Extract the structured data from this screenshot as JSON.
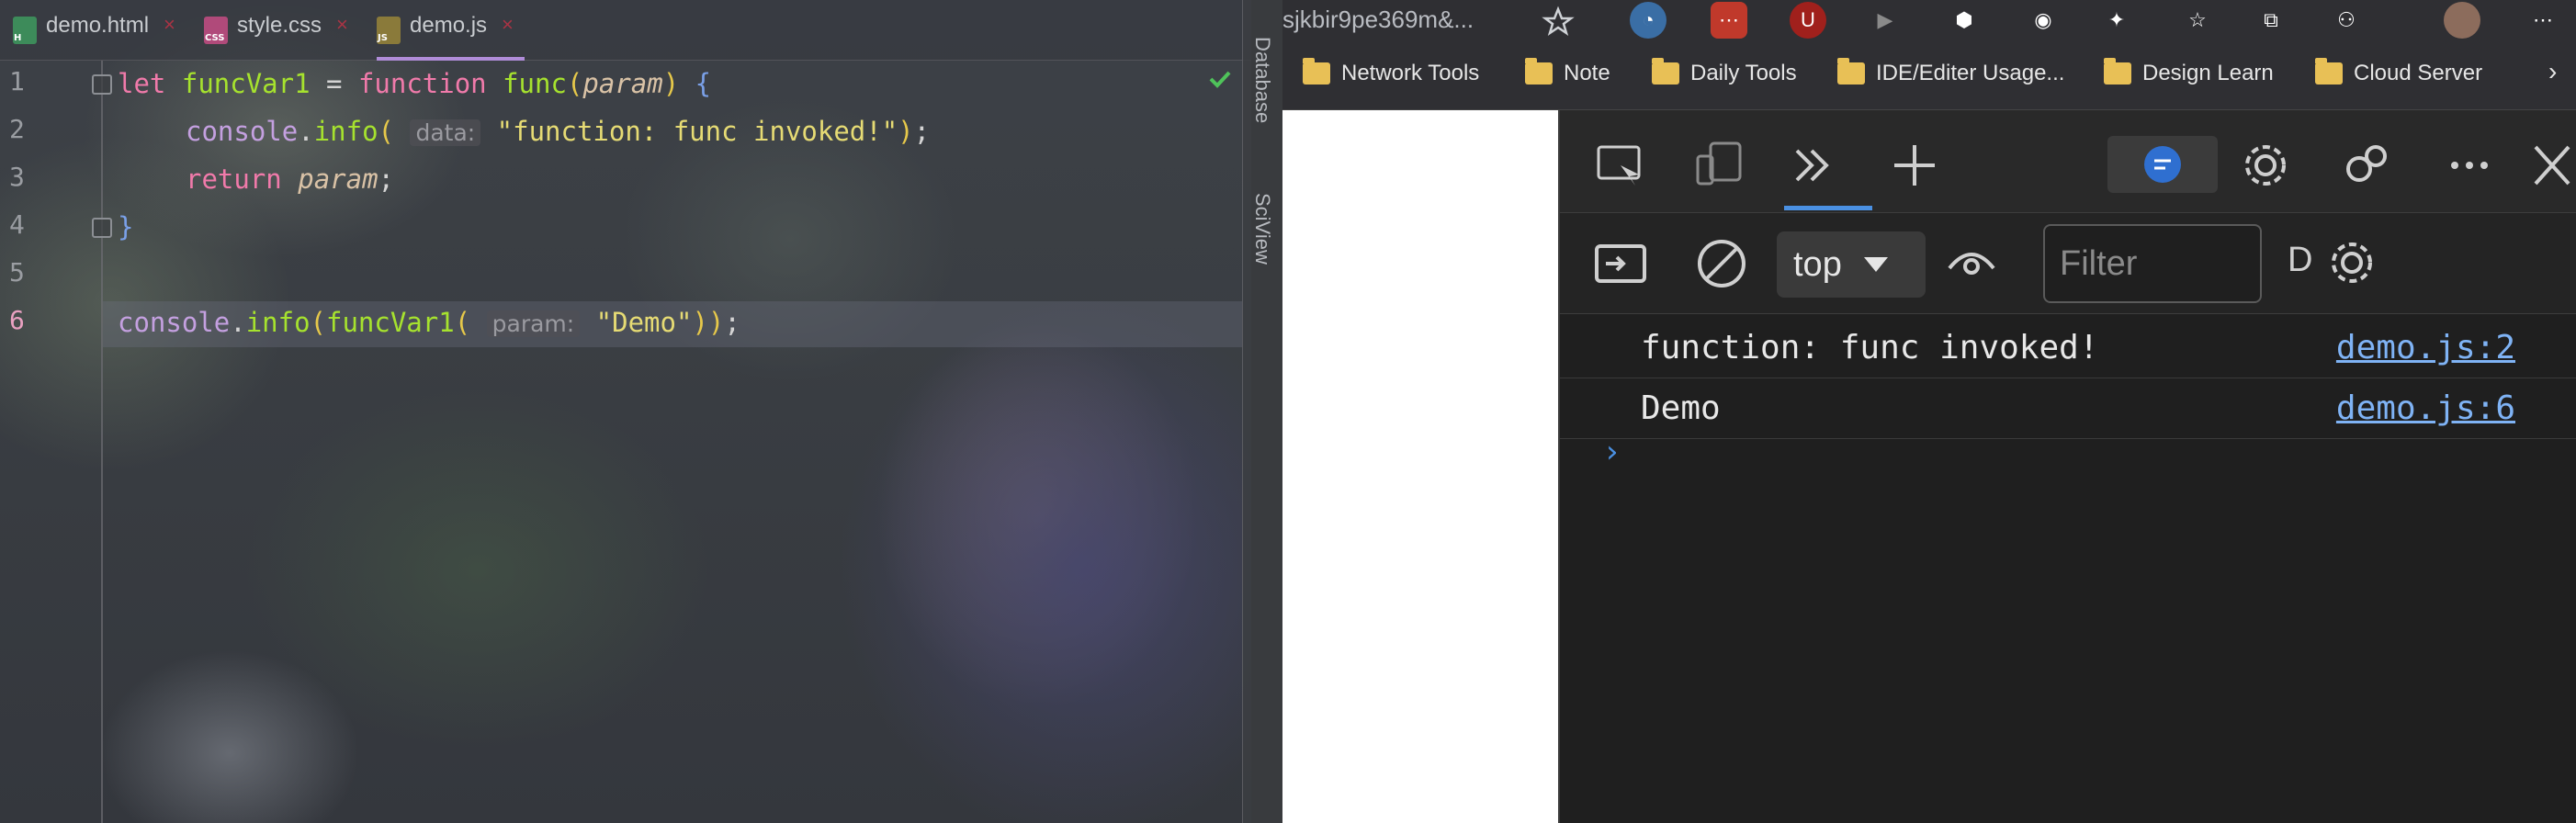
{
  "ide": {
    "tabs": [
      {
        "label": "demo.html",
        "icon": "html-file-icon",
        "active": false
      },
      {
        "label": "style.css",
        "icon": "css-file-icon",
        "active": false
      },
      {
        "label": "demo.js",
        "icon": "js-file-icon",
        "active": true
      }
    ],
    "line_numbers": [
      "1",
      "2",
      "3",
      "4",
      "5",
      "6"
    ],
    "current_line": "6",
    "code": {
      "l1_kw": "let",
      "l1_var": "funcVar1",
      "l1_eq": " = ",
      "l1_kw2": "function",
      "l1_fn": "func",
      "l1_param": "param",
      "l2_obj": "console",
      "l2_fn": "info",
      "l2_hint": "data:",
      "l2_str": "\"function: func invoked!\"",
      "l3_kw": "return",
      "l3_param": "param",
      "l6_obj": "console",
      "l6_fn": "info",
      "l6_call": "funcVar1",
      "l6_hint": "param:",
      "l6_str": "\"Demo\""
    },
    "side_tools": [
      "Database",
      "SciView"
    ]
  },
  "browser": {
    "url_fragment": "sjkbir9pe369m&...",
    "bookmarks": [
      "Network Tools",
      "Note",
      "Daily Tools",
      "IDE/Editer Usage...",
      "Design Learn",
      "Cloud Server"
    ],
    "extensions": [
      "star-add-icon",
      "pie-icon",
      "dots-icon",
      "ublock-icon",
      "play-icon",
      "cube-icon",
      "glasses-icon",
      "puzzle-icon",
      "favorites-icon",
      "collections-icon",
      "profile-share-icon",
      "avatar",
      "more-icon"
    ]
  },
  "devtools": {
    "context": "top",
    "filter_placeholder": "Filter",
    "truncated_label": "D",
    "console": [
      {
        "message": "function: func invoked!",
        "source": "demo.js:2"
      },
      {
        "message": "Demo",
        "source": "demo.js:6"
      }
    ],
    "colors": {
      "link": "#7fb3f5",
      "active_tab": "#4a90e2"
    }
  }
}
